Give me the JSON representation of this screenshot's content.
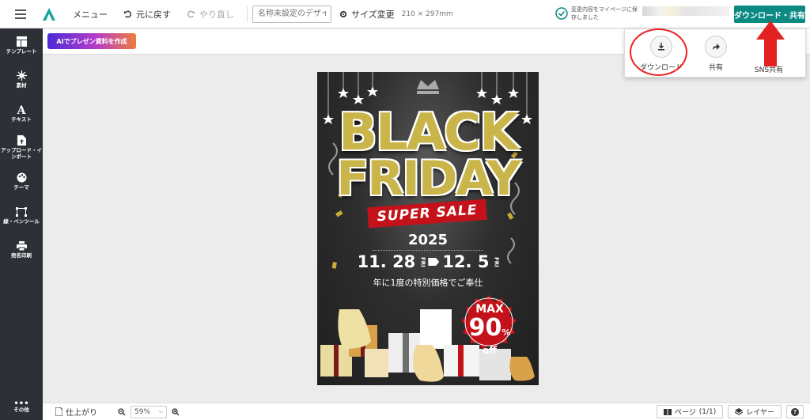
{
  "toolbar": {
    "menu_label": "メニュー",
    "undo_label": "元に戻す",
    "redo_label": "やり直し",
    "design_name_placeholder": "名称未設定のデザイン",
    "resize_label": "サイズ変更",
    "size_dims": "210 × 297mm",
    "saved_status": "変更内容をマイページに保存しました",
    "download_share_label": "ダウンロード・共有"
  },
  "sidebar": {
    "items": [
      {
        "label": "テンプレート",
        "icon": "template-icon"
      },
      {
        "label": "素材",
        "icon": "elements-icon"
      },
      {
        "label": "テキスト",
        "icon": "text-icon"
      },
      {
        "label": "アップロード・インポート",
        "icon": "upload-icon"
      },
      {
        "label": "テーマ",
        "icon": "palette-icon"
      },
      {
        "label": "線・ペンツール",
        "icon": "pen-icon"
      },
      {
        "label": "宛名印刷",
        "icon": "print-icon"
      }
    ],
    "more_label": "その他"
  },
  "subbar": {
    "ai_button_label": "AIでプレゼン資料を作成"
  },
  "download_popup": {
    "download_label": "ダウンロード",
    "share_label": "共有",
    "sns_label": "SNS共有"
  },
  "bottombar": {
    "finish_label": "仕上がり",
    "zoom_value": "59%",
    "pages_label": "ページ",
    "pages_count": "(1/1)",
    "layers_label": "レイヤー"
  },
  "poster": {
    "line1": "BLACK",
    "line2": "FRIDAY",
    "banner": "SUPER SALE",
    "year": "2025",
    "start_date": "11. 28",
    "start_dow": "FRI",
    "end_date": "12. 5",
    "end_dow": "FRI",
    "tagline": "年に1度の特別価格でご奉仕",
    "badge_top": "MAX",
    "badge_value": "90",
    "badge_unit": "%",
    "badge_bottom": "off"
  },
  "colors": {
    "accent": "#0b8a84",
    "sidebar_bg": "#2d3036",
    "annotation_red": "#e22222"
  }
}
